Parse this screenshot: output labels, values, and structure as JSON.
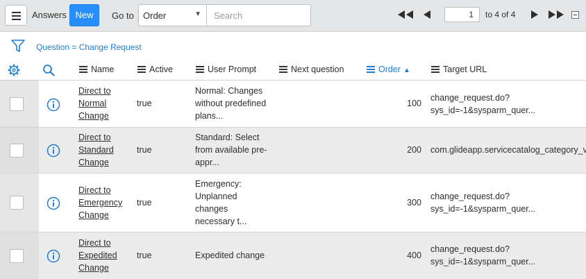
{
  "header": {
    "title": "Answers",
    "new_label": "New",
    "goto_label": "Go to",
    "goto_selected": "Order",
    "search_placeholder": "Search",
    "page_value": "1",
    "page_of": "to 4 of 4"
  },
  "filter": {
    "breadcrumb": "Question = Change Request"
  },
  "columns": {
    "name": "Name",
    "active": "Active",
    "user_prompt": "User Prompt",
    "next_question": "Next question",
    "order": "Order",
    "target_url": "Target URL"
  },
  "rows": [
    {
      "name": "Direct to Normal Change",
      "active": "true",
      "prompt": "Normal: Changes without predefined plans...",
      "order": "100",
      "url1": "change_request.do?",
      "url2": "sys_id=-1&sysparm_quer..."
    },
    {
      "name": "Direct to Standard Change",
      "active": "true",
      "prompt": "Standard: Select from available pre-appr...",
      "order": "200",
      "url1": "com.glideapp.servicecatalog_category_vi",
      "url2": ""
    },
    {
      "name": "Direct to Emergency Change",
      "active": "true",
      "prompt": "Emergency: Unplanned changes necessary t...",
      "order": "300",
      "url1": "change_request.do?",
      "url2": "sys_id=-1&sysparm_quer..."
    },
    {
      "name": "Direct to Expedited Change",
      "active": "true",
      "prompt": "Expedited change",
      "order": "400",
      "url1": "change_request.do?",
      "url2": "sys_id=-1&sysparm_quer..."
    }
  ],
  "colors": {
    "accent": "#278efc",
    "link": "#1e7ed6",
    "header_bg": "#e4e6e8"
  },
  "icons": {
    "menu": "hamburger-icon",
    "first": "first-page-icon",
    "prev": "prev-page-icon",
    "next": "next-page-icon",
    "last": "last-page-icon",
    "collapse": "collapse-icon",
    "filter": "funnel-icon",
    "gear": "gear-icon",
    "search": "search-icon",
    "info": "info-icon"
  }
}
